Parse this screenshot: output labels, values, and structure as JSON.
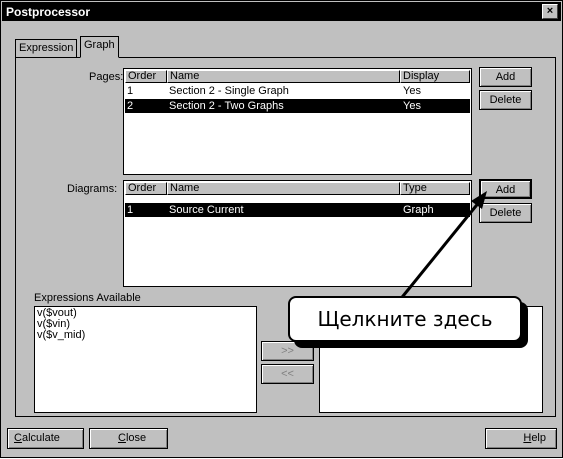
{
  "window": {
    "title": "Postprocessor",
    "close_glyph": "×"
  },
  "tabs": [
    {
      "label": "Expression",
      "active": false
    },
    {
      "label": "Graph",
      "active": true
    }
  ],
  "pages": {
    "label": "Pages:",
    "columns": [
      "Order",
      "Name",
      "Display"
    ],
    "rows": [
      {
        "order": "1",
        "name": "Section 2 - Single Graph",
        "display": "Yes",
        "selected": false
      },
      {
        "order": "2",
        "name": "Section 2 - Two Graphs",
        "display": "Yes",
        "selected": true
      }
    ],
    "add_label": "Add",
    "delete_label": "Delete"
  },
  "diagrams": {
    "label": "Diagrams:",
    "columns": [
      "Order",
      "Name",
      "Type"
    ],
    "rows": [
      {
        "order": "1",
        "name": "Source Current",
        "type": "Graph",
        "selected": true
      }
    ],
    "add_label": "Add",
    "delete_label": "Delete"
  },
  "expressions": {
    "label": "Expressions Available",
    "items": [
      "v($vout)",
      "v($vin)",
      "v($v_mid)"
    ],
    "add_arrow": ">>",
    "remove_arrow": "<<"
  },
  "callout": {
    "text": "Щелкните здесь"
  },
  "footer": {
    "calculate_prefix": "C",
    "calculate_rest": "alculate",
    "close_prefix": "C",
    "close_rest": "lose",
    "help_prefix": "H",
    "help_rest": "elp"
  },
  "colors": {
    "window_bg": "#c0c0c0",
    "selection": "#000000",
    "list_bg": "#ffffff"
  }
}
